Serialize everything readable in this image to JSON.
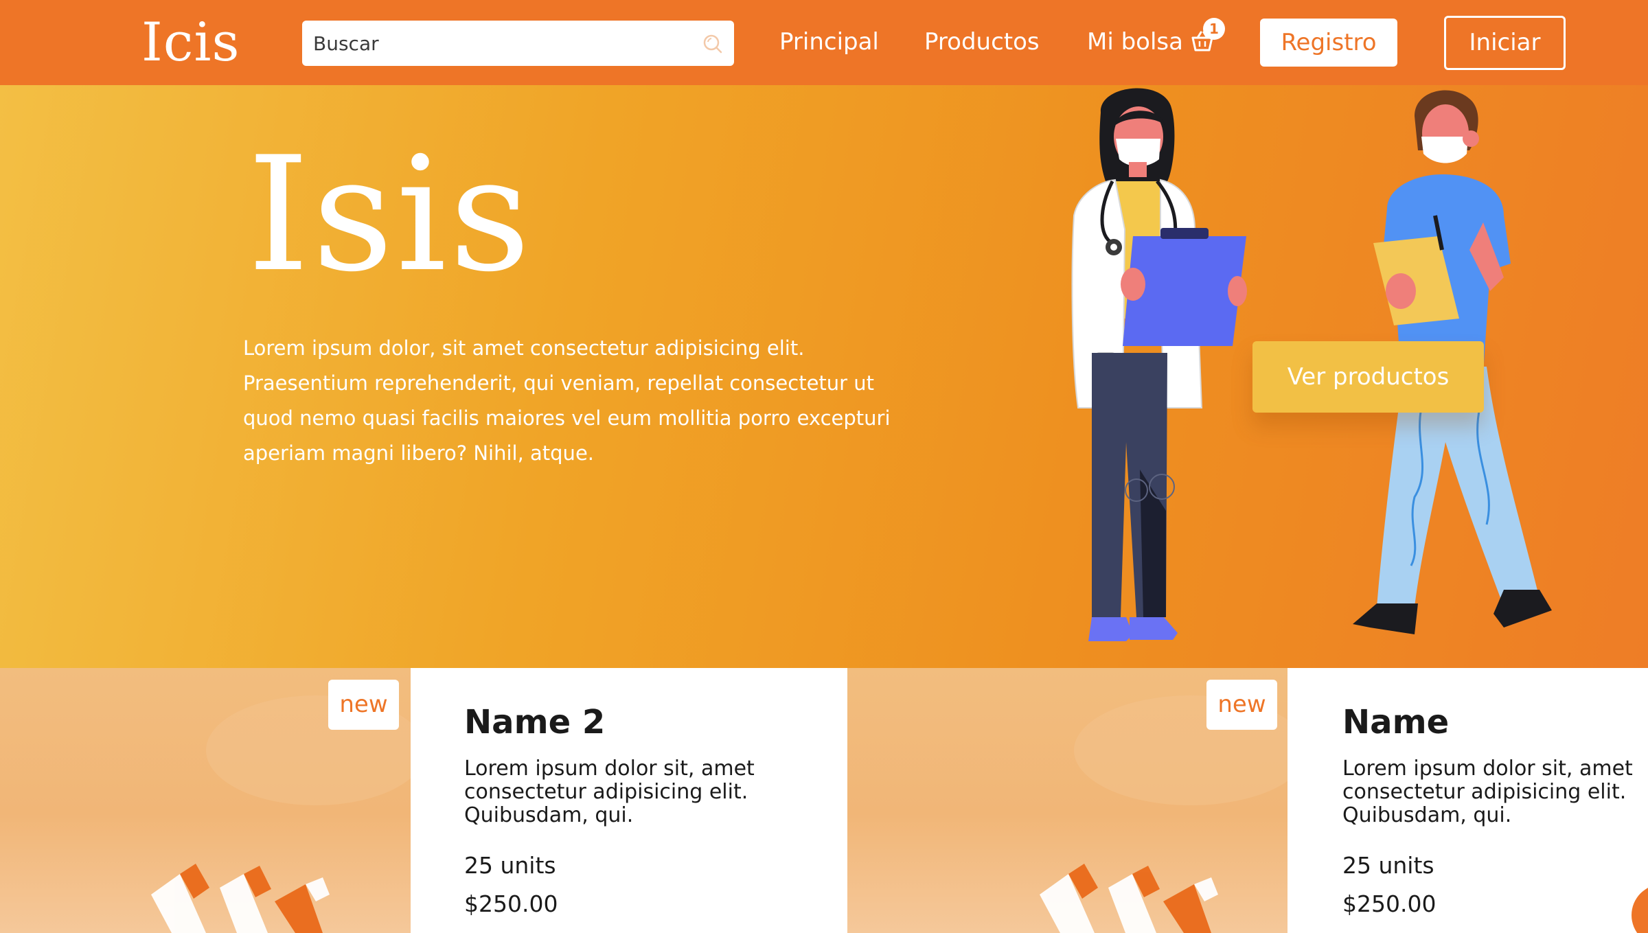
{
  "header": {
    "brand": "Icis",
    "search_placeholder": "Buscar",
    "nav": {
      "principal": "Principal",
      "productos": "Productos",
      "bolsa": "Mi bolsa"
    },
    "cart_count": "1",
    "registro": "Registro",
    "iniciar": "Iniciar"
  },
  "hero": {
    "title": "Isis",
    "text": "Lorem ipsum dolor, sit amet consectetur adipisicing elit. Praesentium reprehenderit, qui veniam, repellat consectetur ut quod nemo quasi facilis maiores vel eum mollitia porro excepturi aperiam magni libero? Nihil, atque.",
    "cta": "Ver productos"
  },
  "products": [
    {
      "badge": "new",
      "name": "Name 2",
      "description": "Lorem ipsum dolor sit, amet consectetur adipisicing elit. Quibusdam, qui.",
      "units": "25 units",
      "price": "$250.00"
    },
    {
      "badge": "new",
      "name": "Name",
      "description": "Lorem ipsum dolor sit, amet consectetur adipisicing elit. Quibusdam, qui.",
      "units": "25 units",
      "price": "$250.00"
    }
  ],
  "colors": {
    "primary": "#ee7527",
    "hero_start": "#f3bf44",
    "hero_end": "#ee7d26",
    "cta": "#f2c045"
  },
  "icons": [
    "search-icon",
    "basket-icon"
  ]
}
